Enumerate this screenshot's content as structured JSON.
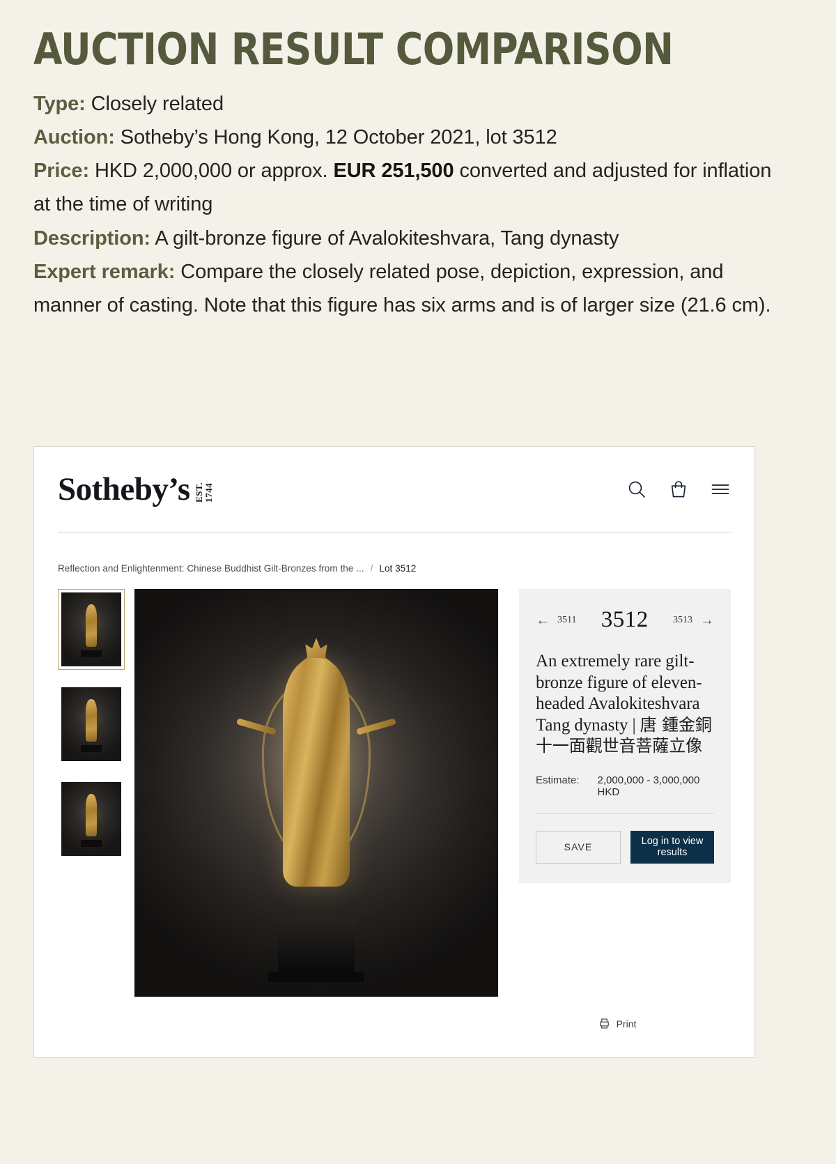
{
  "report": {
    "title": "AUCTION RESULT COMPARISON",
    "fields": {
      "type_label": "Type:",
      "type_value": "Closely related",
      "auction_label": "Auction:",
      "auction_value": "Sotheby’s Hong Kong, 12 October 2021, lot 3512",
      "price_label": "Price:",
      "price_value_pre": "HKD 2,000,000 or approx.",
      "price_value_strong": "EUR 251,500",
      "price_value_post": "converted and adjusted for inflation at the time of writing",
      "description_label": "Description:",
      "description_value": "A gilt-bronze figure of Avalokiteshvara, Tang dynasty",
      "remark_label": "Expert remark:",
      "remark_value": "Compare the closely related pose, depiction, expression, and manner of casting. Note that this figure has six arms and is of larger size (21.6 cm)."
    },
    "accent_color": "#565a3d",
    "background_color": "#f4f1e9"
  },
  "screenshot": {
    "site": {
      "logo_text": "Sotheby’s",
      "logo_est_top": "EST.",
      "logo_est_bottom": "1744",
      "icons": {
        "search": "search-icon",
        "bag": "shopping-bag-icon",
        "menu": "hamburger-menu-icon"
      }
    },
    "breadcrumb": {
      "sale": "Reflection and Enlightenment: Chinese Buddhist Gilt-Bronzes from the ...",
      "separator": "/",
      "current": "Lot 3512"
    },
    "gallery": {
      "thumbnail_count": 3,
      "selected_index": 0,
      "thumb_alt": "gilt-bronze standing figure on black plinth"
    },
    "lot": {
      "prev_arrow": "←",
      "prev_lot": "3511",
      "current_lot": "3512",
      "next_lot": "3513",
      "next_arrow": "→",
      "title_en": "An extremely rare gilt-bronze figure of eleven-headed Avalokiteshvara",
      "title_period": "Tang dynasty | ",
      "title_cn": "唐 鍾金銅十一面觀世音菩薩立像",
      "estimate_label": "Estimate:",
      "estimate_value": "2,000,000 - 3,000,000 HKD",
      "save_button": "SAVE",
      "login_button": "Log in to view results",
      "print_label": "Print",
      "accent_navy": "#0d3049",
      "panel_bg": "#f1f1f1",
      "selected_thumb_border": "#b9a46a"
    }
  }
}
